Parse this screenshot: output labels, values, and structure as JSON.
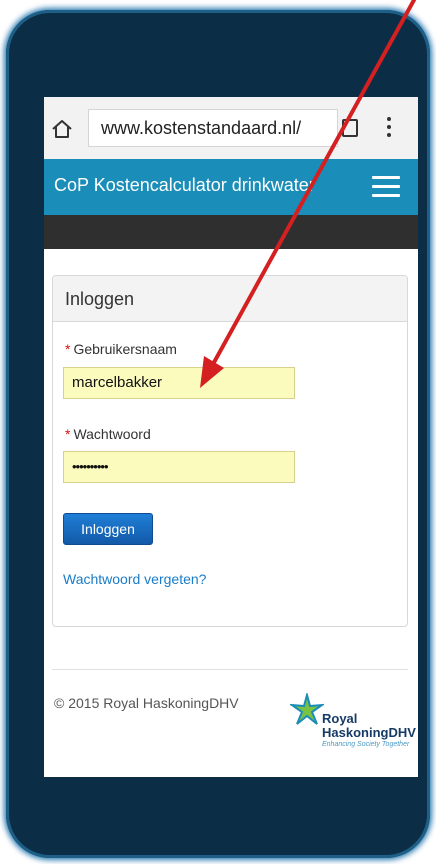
{
  "browser": {
    "url": "www.kostenstandaard.nl/"
  },
  "header": {
    "title": "CoP Kostencalculator drinkwater"
  },
  "login_panel": {
    "heading": "Inloggen",
    "required_marker": "*",
    "username_label": "Gebruikersnaam",
    "username_value": "marcelbakker",
    "password_label": "Wachtwoord",
    "password_value": "••••••••••",
    "submit_label": "Inloggen",
    "forgot_link": "Wachtwoord vergeten?"
  },
  "footer": {
    "copyright": "© 2015 Royal HaskoningDHV",
    "logo_line1": "Royal",
    "logo_line2": "HaskoningDHV",
    "logo_tagline": "Enhancing Society Together"
  },
  "colors": {
    "app_bar": "#1a8db8",
    "dark_bar": "#2f2f2f",
    "autofill_field": "#fbfbbe",
    "primary_button": "#1a6cc0",
    "link": "#1a7cc8",
    "annotation_arrow": "#d42020",
    "device_frame": "#0b2e46"
  }
}
